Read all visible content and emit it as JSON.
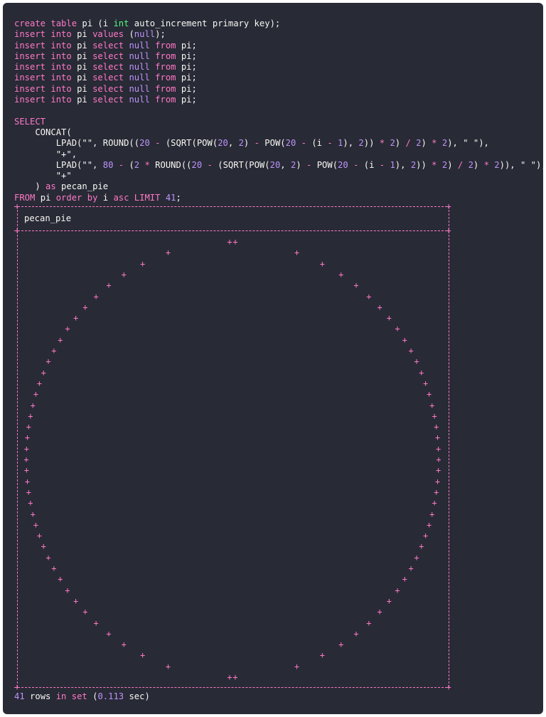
{
  "code_lines": [
    [
      [
        "kw",
        "create "
      ],
      [
        "kw",
        "table "
      ],
      [
        "fn",
        "pi (i "
      ],
      [
        "type",
        "int "
      ],
      [
        "fn",
        "auto_increment primary key);"
      ]
    ],
    [
      [
        "kw",
        "insert into "
      ],
      [
        "fn",
        "pi "
      ],
      [
        "kw",
        "values "
      ],
      [
        "fn",
        "("
      ],
      [
        "num",
        "null"
      ],
      [
        "fn",
        ");"
      ]
    ],
    [
      [
        "kw",
        "insert into "
      ],
      [
        "fn",
        "pi "
      ],
      [
        "kw",
        "select "
      ],
      [
        "num",
        "null "
      ],
      [
        "kw",
        "from "
      ],
      [
        "fn",
        "pi;"
      ]
    ],
    [
      [
        "kw",
        "insert into "
      ],
      [
        "fn",
        "pi "
      ],
      [
        "kw",
        "select "
      ],
      [
        "num",
        "null "
      ],
      [
        "kw",
        "from "
      ],
      [
        "fn",
        "pi;"
      ]
    ],
    [
      [
        "kw",
        "insert into "
      ],
      [
        "fn",
        "pi "
      ],
      [
        "kw",
        "select "
      ],
      [
        "num",
        "null "
      ],
      [
        "kw",
        "from "
      ],
      [
        "fn",
        "pi;"
      ]
    ],
    [
      [
        "kw",
        "insert into "
      ],
      [
        "fn",
        "pi "
      ],
      [
        "kw",
        "select "
      ],
      [
        "num",
        "null "
      ],
      [
        "kw",
        "from "
      ],
      [
        "fn",
        "pi;"
      ]
    ],
    [
      [
        "kw",
        "insert into "
      ],
      [
        "fn",
        "pi "
      ],
      [
        "kw",
        "select "
      ],
      [
        "num",
        "null "
      ],
      [
        "kw",
        "from "
      ],
      [
        "fn",
        "pi;"
      ]
    ],
    [
      [
        "kw",
        "insert into "
      ],
      [
        "fn",
        "pi "
      ],
      [
        "kw",
        "select "
      ],
      [
        "num",
        "null "
      ],
      [
        "kw",
        "from "
      ],
      [
        "fn",
        "pi;"
      ]
    ],
    [],
    [
      [
        "kw",
        "SELECT"
      ]
    ],
    [
      [
        "fn",
        "    CONCAT("
      ]
    ],
    [
      [
        "fn",
        "        LPAD(\"\", ROUND(("
      ],
      [
        "num",
        "20"
      ],
      [
        "op",
        " - "
      ],
      [
        "fn",
        "(SQRT(POW("
      ],
      [
        "num",
        "20"
      ],
      [
        "fn",
        ", "
      ],
      [
        "num",
        "2"
      ],
      [
        "fn",
        ")"
      ],
      [
        "op",
        " - "
      ],
      [
        "fn",
        "POW("
      ],
      [
        "num",
        "20"
      ],
      [
        "op",
        " - "
      ],
      [
        "fn",
        "(i"
      ],
      [
        "op",
        " - "
      ],
      [
        "num",
        "1"
      ],
      [
        "fn",
        "), "
      ],
      [
        "num",
        "2"
      ],
      [
        "fn",
        "))"
      ],
      [
        "op",
        " * "
      ],
      [
        "num",
        "2"
      ],
      [
        "fn",
        ")"
      ],
      [
        "op",
        " / "
      ],
      [
        "num",
        "2"
      ],
      [
        "fn",
        ")"
      ],
      [
        "op",
        " * "
      ],
      [
        "num",
        "2"
      ],
      [
        "fn",
        "), \" \"),"
      ]
    ],
    [
      [
        "str",
        "        \"+\","
      ]
    ],
    [
      [
        "fn",
        "        LPAD(\"\", "
      ],
      [
        "num",
        "80"
      ],
      [
        "op",
        " - "
      ],
      [
        "fn",
        "("
      ],
      [
        "num",
        "2"
      ],
      [
        "op",
        " * "
      ],
      [
        "fn",
        "ROUND(("
      ],
      [
        "num",
        "20"
      ],
      [
        "op",
        " - "
      ],
      [
        "fn",
        "(SQRT(POW("
      ],
      [
        "num",
        "20"
      ],
      [
        "fn",
        ", "
      ],
      [
        "num",
        "2"
      ],
      [
        "fn",
        ")"
      ],
      [
        "op",
        " - "
      ],
      [
        "fn",
        "POW("
      ],
      [
        "num",
        "20"
      ],
      [
        "op",
        " - "
      ],
      [
        "fn",
        "(i"
      ],
      [
        "op",
        " - "
      ],
      [
        "num",
        "1"
      ],
      [
        "fn",
        "), "
      ],
      [
        "num",
        "2"
      ],
      [
        "fn",
        "))"
      ],
      [
        "op",
        " * "
      ],
      [
        "num",
        "2"
      ],
      [
        "fn",
        ")"
      ],
      [
        "op",
        " / "
      ],
      [
        "num",
        "2"
      ],
      [
        "fn",
        ")"
      ],
      [
        "op",
        " * "
      ],
      [
        "num",
        "2"
      ],
      [
        "fn",
        ")), \" \"),"
      ]
    ],
    [
      [
        "str",
        "        \"+\""
      ]
    ],
    [
      [
        "fn",
        "    ) "
      ],
      [
        "kw",
        "as "
      ],
      [
        "fn",
        "pecan_pie"
      ]
    ],
    [
      [
        "kw",
        "FROM "
      ],
      [
        "fn",
        "pi "
      ],
      [
        "kw",
        "order by "
      ],
      [
        "fn",
        "i "
      ],
      [
        "kw",
        "asc "
      ],
      [
        "kw",
        "LIMIT "
      ],
      [
        "num",
        "41"
      ],
      [
        "fn",
        ";"
      ]
    ]
  ],
  "result": {
    "header": "pecan_pie",
    "row_count": "41",
    "rows_text": " rows ",
    "in_text": "in ",
    "set_text": "set ",
    "time": "0.113",
    "sec_text": " sec)",
    "plus": "+"
  },
  "circle": {
    "radius": 20,
    "rows": 41
  },
  "colors": {
    "background": "#282a36",
    "keyword": "#ff79c6",
    "number": "#bd93f9",
    "type": "#50fa7b",
    "text": "#f8f8f2"
  }
}
